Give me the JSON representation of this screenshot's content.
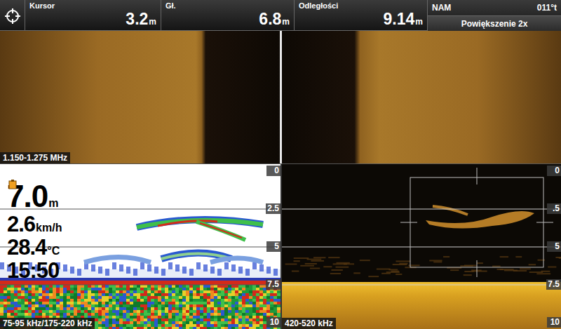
{
  "header": {
    "fields": [
      {
        "label": "Kursor",
        "value": "3.2",
        "unit": "m"
      },
      {
        "label": "Gł.",
        "value": "6.8",
        "unit": "m"
      },
      {
        "label": "Odległości",
        "value": "9.14",
        "unit": "m"
      }
    ],
    "heading": {
      "label": "NAM",
      "value": "011°t"
    },
    "zoom": "Powiększenie 2x"
  },
  "side_imaging": {
    "frequency": "1.150-1.275 MHz"
  },
  "sonar_2d": {
    "frequency": "75-95 kHz/175-220 kHz",
    "readouts": [
      {
        "value": "7.0",
        "unit": "m"
      },
      {
        "value": "2.6",
        "unit": "km/h"
      },
      {
        "value": "28.4",
        "unit": "°C"
      },
      {
        "value": "15:50",
        "unit": ""
      }
    ],
    "scale": [
      "0",
      "2.5",
      "5",
      "7.5",
      "10"
    ]
  },
  "down_imaging": {
    "frequency": "420-520 kHz",
    "scale": [
      "0",
      ".5",
      "5",
      "7.5",
      "10"
    ]
  }
}
